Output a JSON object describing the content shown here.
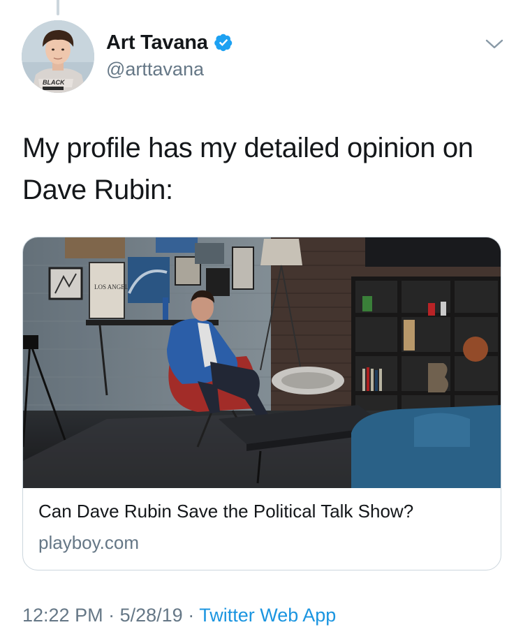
{
  "author": {
    "display_name": "Art Tavana",
    "handle": "@arttavana",
    "verified": true,
    "avatar_shirt_text": "BLACK"
  },
  "tweet": {
    "text": "My profile has my detailed opinion on Dave Rubin:"
  },
  "card": {
    "title": "Can Dave Rubin Save the Political Talk Show?",
    "domain": "playboy.com",
    "image_sign_text": "LOS ANGELES"
  },
  "meta": {
    "time": "12:22 PM",
    "separator": "·",
    "date": "5/28/19",
    "source": "Twitter Web App"
  },
  "icons": {
    "verified": "verified-badge-icon",
    "more": "chevron-down-icon"
  },
  "colors": {
    "text_primary": "#14171a",
    "text_secondary": "#657786",
    "link": "#1b95e0",
    "verified": "#1da1f2",
    "border": "#ccd6dd"
  }
}
